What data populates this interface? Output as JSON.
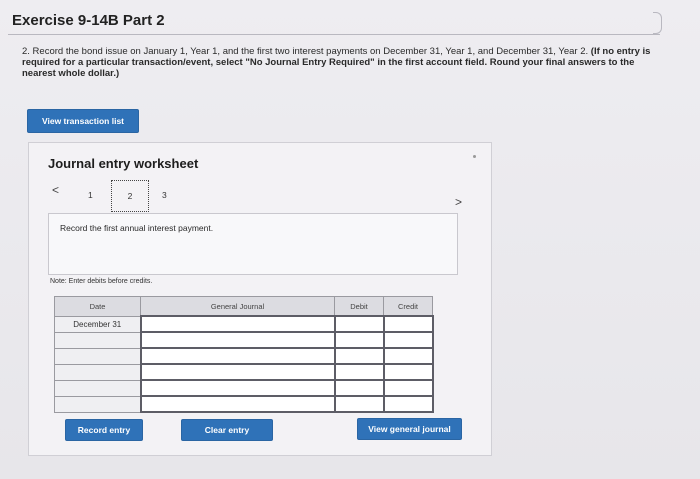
{
  "header": {
    "title": "Exercise 9-14B Part 2"
  },
  "instructions": {
    "part1": "2. Record the bond issue on January 1, Year 1, and the first two interest payments on December 31, Year 1, and December 31, Year 2.",
    "part2": "(If no entry is required for a particular transaction/event, select \"No Journal Entry Required\" in the first account field. Round your final answers to the nearest whole dollar.)"
  },
  "buttons": {
    "view_transaction_list": "View transaction list",
    "record_entry": "Record entry",
    "clear_entry": "Clear entry",
    "view_general_journal": "View general journal"
  },
  "worksheet": {
    "title": "Journal entry worksheet",
    "prev_icon": "chevron-left-icon",
    "next_icon": "chevron-right-icon",
    "pages": [
      "1",
      "2",
      "3"
    ],
    "current_page": "2",
    "instruction": "Record the first annual interest payment.",
    "note": "Note: Enter debits before credits."
  },
  "table": {
    "headers": {
      "date": "Date",
      "general_journal": "General Journal",
      "debit": "Debit",
      "credit": "Credit"
    },
    "date_value": "December 31",
    "rows": 6
  }
}
